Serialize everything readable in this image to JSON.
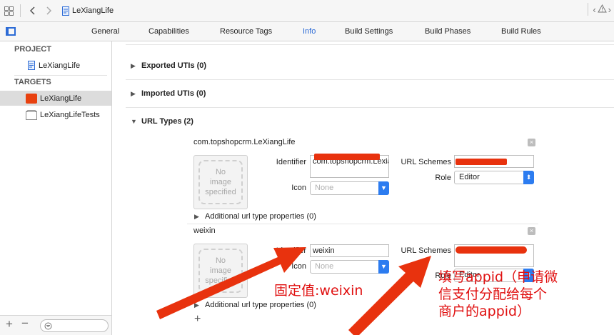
{
  "window": {
    "file_name": "LeXiangLife"
  },
  "tabs": [
    {
      "label": "General"
    },
    {
      "label": "Capabilities"
    },
    {
      "label": "Resource Tags"
    },
    {
      "label": "Info"
    },
    {
      "label": "Build Settings"
    },
    {
      "label": "Build Phases"
    },
    {
      "label": "Build Rules"
    }
  ],
  "sidebar": {
    "project_header": "PROJECT",
    "project_item": "LeXiangLife",
    "targets_header": "TARGETS",
    "targets": [
      {
        "label": "LeXiangLife"
      },
      {
        "label": "LeXiangLifeTests"
      }
    ]
  },
  "main": {
    "exported_utis": "Exported UTIs (0)",
    "imported_utis": "Imported UTIs (0)",
    "url_types": "URL Types (2)",
    "entries": [
      {
        "title": "com.topshopcrm.LeXiangLife",
        "image_placeholder": "No\nimage\nspecified",
        "identifier_label": "Identifier",
        "identifier_value": "com.topshopcrm.LexiangLife",
        "icon_label": "Icon",
        "icon_placeholder": "None",
        "schemes_label": "URL Schemes",
        "role_label": "Role",
        "role_value": "Editor",
        "additional": "Additional url type properties (0)"
      },
      {
        "title": "weixin",
        "image_placeholder": "No\nimage\nspecified",
        "identifier_label": "Identifier",
        "identifier_value": "weixin",
        "icon_label": "Icon",
        "icon_placeholder": "None",
        "schemes_label": "URL Schemes",
        "role_label": "Role",
        "role_value": "Editor",
        "additional": "Additional url type properties (0)"
      }
    ]
  },
  "annotations": {
    "fixed_value": "固定值:weixin",
    "fill_appid": "填写appid（申请微\n信支付分配给每个\n商户的appid）"
  },
  "colors": {
    "accent": "#2c6bd6",
    "annotation_red": "#e01010",
    "redaction": "#e8320e"
  }
}
